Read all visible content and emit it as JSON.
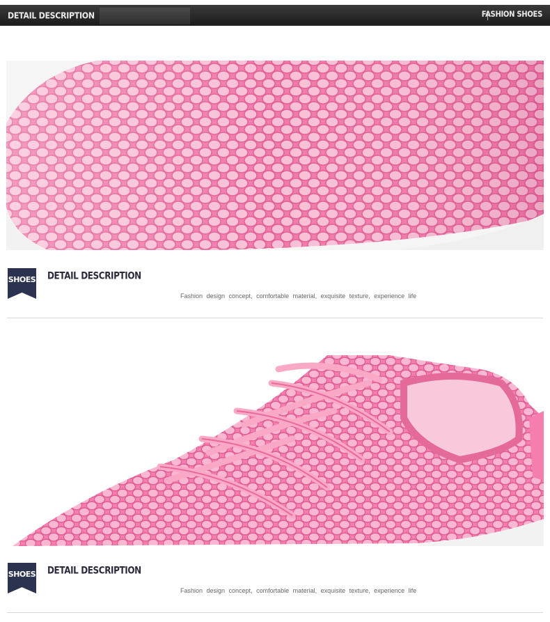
{
  "header": {
    "title": "DETAIL DESCRIPTION",
    "right_label": "FASHION SHOES"
  },
  "sections": [
    {
      "badge": "SHOES",
      "heading": "DETAIL DESCRIPTION",
      "caption": "Fashion design concept, comfortable material, exquisite texture, experience life"
    },
    {
      "badge": "SHOES",
      "heading": "DETAIL DESCRIPTION",
      "caption": "Fashion design concept, comfortable material, exquisite texture, experience life"
    }
  ],
  "colors": {
    "topbar": "#242424",
    "badge": "#2b3350",
    "mesh_pink": "#f27fac",
    "mesh_light": "#f7b8d0",
    "sole": "#f4f4f4"
  }
}
